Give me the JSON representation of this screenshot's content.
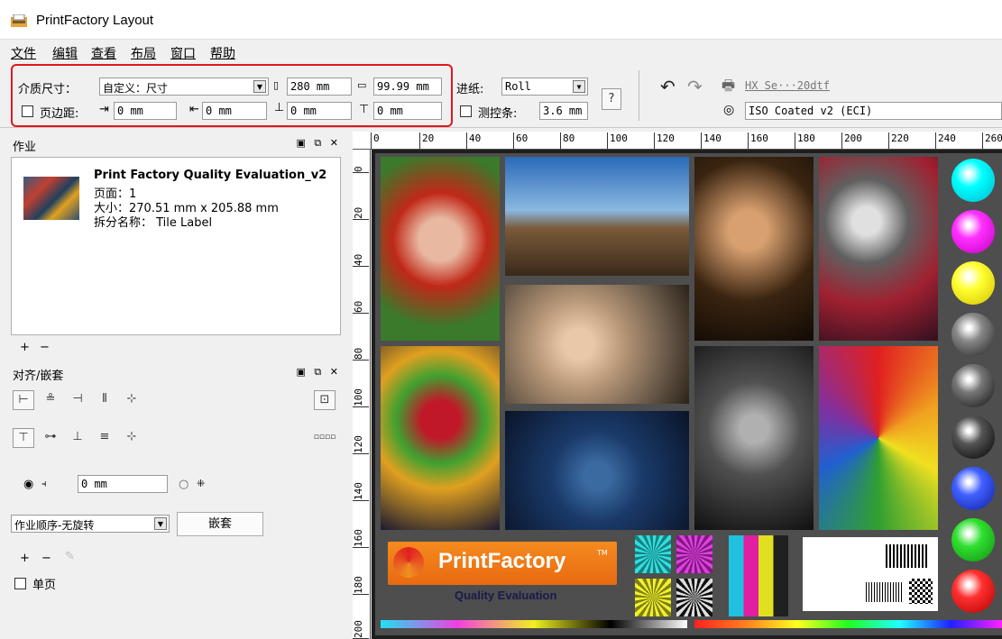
{
  "window": {
    "title": "PrintFactory Layout"
  },
  "menu": [
    "文件",
    "编辑",
    "查看",
    "布局",
    "窗口",
    "帮助"
  ],
  "toolbar": {
    "media_size_label": "介质尺寸：",
    "media_size_value": "自定义：尺寸",
    "width_value": "280 mm",
    "height_value": "99.99 mm",
    "margin_label": "页边距:",
    "margin_left": "0 mm",
    "margin_right": "0 mm",
    "margin_top": "0 mm",
    "margin_bottom": "0 mm",
    "feed_label": "进纸:",
    "feed_value": "Roll",
    "control_strip_label": "测控条:",
    "control_strip_value": "3.6 mm",
    "help_label": "?",
    "printer_link": "HX Se···20dtf",
    "profile_value": "ISO Coated v2 (ECI)"
  },
  "jobs_panel": {
    "title": "作业",
    "job": {
      "name": "Print Factory Quality Evaluation_v2",
      "pages": "页面：1",
      "size": "大小：270.51 mm x 205.88 mm",
      "tile": "拆分名称： Tile Label"
    },
    "add": "+",
    "remove": "−"
  },
  "align_panel": {
    "title": "对齐/嵌套",
    "spacing_value": "0 mm",
    "order_value": "作业顺序-无旋转",
    "nest_button": "嵌套",
    "add": "+",
    "remove": "−",
    "single_page_label": "单页"
  },
  "ruler": {
    "top": [
      "0",
      "20",
      "40",
      "60",
      "80",
      "100",
      "120",
      "140",
      "160",
      "180",
      "200",
      "220",
      "240",
      "260"
    ],
    "left": [
      "0",
      "20",
      "40",
      "60",
      "80",
      "100",
      "120",
      "140",
      "160",
      "180",
      "200"
    ]
  },
  "canvas": {
    "logo_text": "PrintFactory",
    "tm": "TM",
    "logo_sub": "Quality Evaluation"
  },
  "colors": {
    "highlight": "#e0191b",
    "logo_orange": "#f58a1f"
  }
}
